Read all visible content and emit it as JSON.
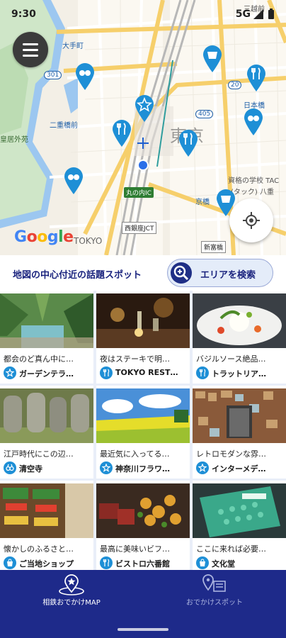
{
  "status_bar": {
    "time": "9:30",
    "network": "5G"
  },
  "map": {
    "google_logo": [
      "G",
      "o",
      "o",
      "g",
      "l",
      "e"
    ],
    "labels": {
      "otemachi": "大手町",
      "nijubashi": "二重橋前",
      "kokyo": "皇居外苑",
      "tokyo_big": "東京",
      "nihonbashi": "日本橋",
      "shikaku": "資格の学校 TAC",
      "tac": "(タック) 八重",
      "kyobashi": "京橋",
      "marunouchi": "丸の内IC",
      "nishiginza": "西銀座JCT",
      "shintomi": "新富橋",
      "tokyo_small": "TOKYO",
      "mitsukoshi": "三越前",
      "route301": "301",
      "route405": "405",
      "route20": "20"
    }
  },
  "search": {
    "title": "地図の中心付近の話題スポット",
    "area_button": "エリアを検索"
  },
  "cards": [
    {
      "desc": "都会のど真ん中に…",
      "name": "ガーデンテラ…",
      "category_icon": "star-icon"
    },
    {
      "desc": "夜はステーキで明…",
      "name": "TOKYO REST…",
      "category_icon": "fork-knife-icon"
    },
    {
      "desc": "バジルソース絶品…",
      "name": "トラットリア…",
      "category_icon": "fork-knife-icon"
    },
    {
      "desc": "江戸時代にこの辺…",
      "name": "清空寺",
      "category_icon": "binoculars-icon"
    },
    {
      "desc": "最近気に入ってる…",
      "name": "神奈川フラワ…",
      "category_icon": "star-icon"
    },
    {
      "desc": "レトロモダンな雰…",
      "name": "インターメデ…",
      "category_icon": "star-icon"
    },
    {
      "desc": "懐かしのふるさと…",
      "name": "ご当地ショップ",
      "category_icon": "shopping-bag-icon"
    },
    {
      "desc": "最高に美味いビフ…",
      "name": "ビストロ六番館",
      "category_icon": "fork-knife-icon"
    },
    {
      "desc": "ここに来れば必要…",
      "name": "文化堂",
      "category_icon": "shopping-bag-icon"
    }
  ],
  "bottom_nav": {
    "map_label": "相鉄おでかけMAP",
    "spots_label": "おでかけスポット"
  },
  "colors": {
    "nav_bg": "#1e2a8a",
    "pin": "#1e8fd6",
    "accent": "#1a237e"
  }
}
